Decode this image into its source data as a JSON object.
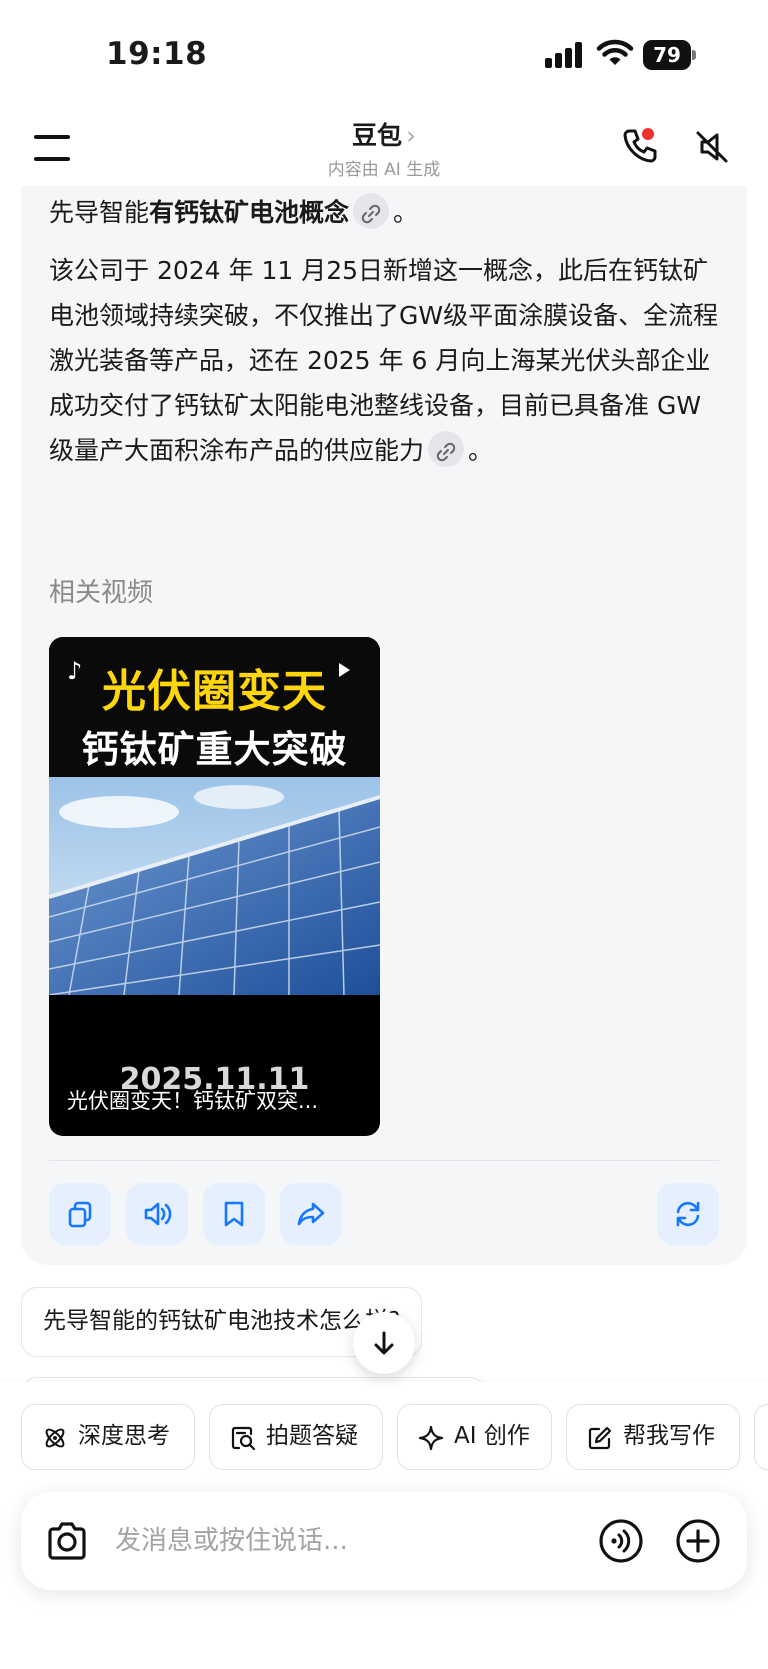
{
  "status_bar": {
    "time": "19:18",
    "battery": "79"
  },
  "nav": {
    "title": "豆包",
    "title_chevron": "›",
    "subtitle": "内容由 AI 生成"
  },
  "answer": {
    "line1_pre": "先导智能",
    "line1_bold": "有钙钛矿电池概念",
    "line1_post": "。",
    "para2": "该公司于 2024 年 11 月25日新增这一概念，此后在钙钛矿电池领域持续突破，不仅推出了GW级平面涂膜设备、全流程激光装备等产品，还在 2025 年 6 月向上海某光伏头部企业成功交付了钙钛矿太阳能电池整线设备，目前已具备准 GW 级量产大面积涂布产品的供应能力",
    "para2_post": "。",
    "related_label": "相关视频",
    "video": {
      "headline": "光伏圈变天",
      "subheadline": "钙钛矿重大突破",
      "date": "2025.11.11",
      "caption": "光伏圈变天！钙钛矿双突..."
    }
  },
  "suggestions": [
    "先导智能的钙钛矿电池技术怎么样?"
  ],
  "quick_actions": [
    {
      "label": "深度思考",
      "icon": "atom-icon"
    },
    {
      "label": "拍题答疑",
      "icon": "scan-question-icon"
    },
    {
      "label": "AI 创作",
      "icon": "sparkle-icon"
    },
    {
      "label": "帮我写作",
      "icon": "edit-icon"
    }
  ],
  "input": {
    "placeholder": "发消息或按住说话..."
  },
  "colors": {
    "accent": "#1677ff",
    "card_bg": "#f5f6f8",
    "action_bg": "#e6effd",
    "notification": "#f0302d",
    "video_headline": "#ffd60a"
  }
}
